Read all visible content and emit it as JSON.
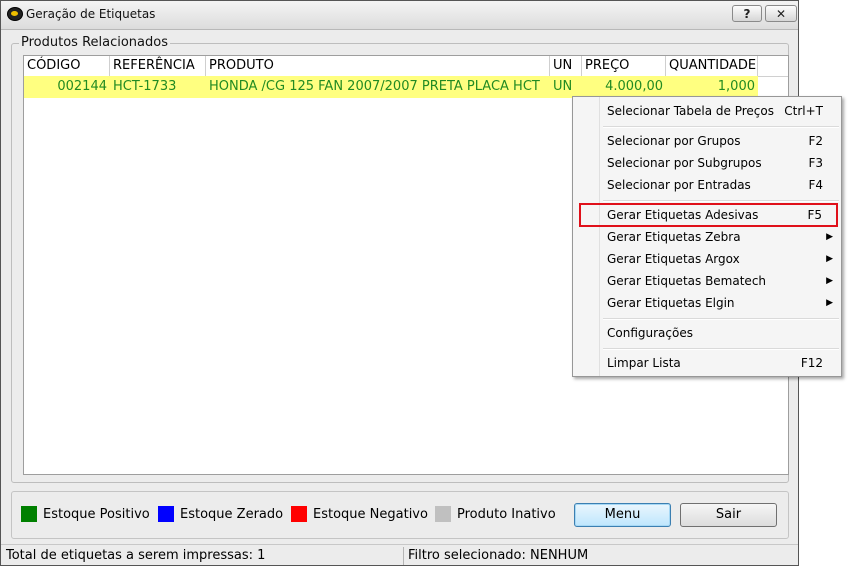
{
  "window": {
    "title": "Geração de Etiquetas",
    "help_label": "?",
    "close_label": "✕"
  },
  "group": {
    "label": "Produtos Relacionados"
  },
  "table": {
    "columns": [
      "CÓDIGO",
      "REFERÊNCIA",
      "PRODUTO",
      "UN",
      "PREÇO",
      "QUANTIDADE"
    ],
    "rows": [
      {
        "codigo": "002144",
        "referencia": "HCT-1733",
        "produto": "HONDA /CG 125 FAN 2007/2007 PRETA  PLACA HCT",
        "un": "UN",
        "preco": "4.000,00",
        "quantidade": "1,000"
      }
    ]
  },
  "context_menu": {
    "items": [
      {
        "label": "Selecionar Tabela de Preços",
        "shortcut": "Ctrl+T"
      },
      {
        "label": "Selecionar por Grupos",
        "shortcut": "F2"
      },
      {
        "label": "Selecionar por Subgrupos",
        "shortcut": "F3"
      },
      {
        "label": "Selecionar por Entradas",
        "shortcut": "F4"
      },
      {
        "label": "Gerar Etiquetas Adesivas",
        "shortcut": "F5",
        "highlighted": true
      },
      {
        "label": "Gerar Etiquetas Zebra",
        "submenu": true
      },
      {
        "label": "Gerar Etiquetas Argox",
        "submenu": true
      },
      {
        "label": "Gerar Etiquetas Bematech",
        "submenu": true
      },
      {
        "label": "Gerar Etiquetas Elgin",
        "submenu": true
      },
      {
        "label": "Configurações"
      },
      {
        "label": "Limpar Lista",
        "shortcut": "F12"
      }
    ]
  },
  "legend": [
    {
      "label": "Estoque Positivo",
      "color": "#008000"
    },
    {
      "label": "Estoque Zerado",
      "color": "#0000ff"
    },
    {
      "label": "Estoque Negativo",
      "color": "#ff0000"
    },
    {
      "label": "Produto Inativo",
      "color": "#c0c0c0"
    }
  ],
  "buttons": {
    "menu": "Menu",
    "sair": "Sair"
  },
  "status": {
    "total": "Total de etiquetas a serem impressas: 1",
    "filter": "Filtro selecionado: NENHUM"
  },
  "colors": {
    "row_bg": "#ffff80",
    "row_text": "#228b22",
    "highlight_border": "#e0101a"
  }
}
